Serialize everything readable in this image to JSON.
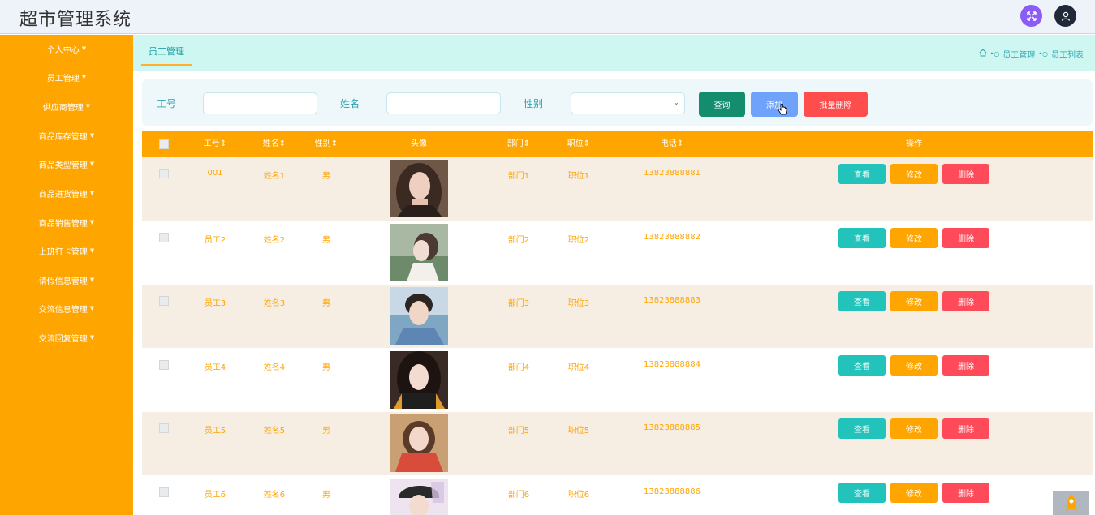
{
  "app": {
    "title": "超市管理系统"
  },
  "header": {
    "expand_icon": "expand-icon",
    "user_icon": "user-icon"
  },
  "sidebar": {
    "items": [
      {
        "label": "个人中心"
      },
      {
        "label": "员工管理"
      },
      {
        "label": "供应商管理"
      },
      {
        "label": "商品库存管理"
      },
      {
        "label": "商品类型管理"
      },
      {
        "label": "商品进货管理"
      },
      {
        "label": "商品销售管理"
      },
      {
        "label": "上班打卡管理"
      },
      {
        "label": "请假信息管理"
      },
      {
        "label": "交流信息管理"
      },
      {
        "label": "交流回复管理"
      }
    ]
  },
  "tabs": {
    "active": "员工管理"
  },
  "breadcrumb": {
    "level1": "员工管理",
    "level2": "员工列表"
  },
  "search": {
    "labels": {
      "emp_no": "工号",
      "name": "姓名",
      "gender": "性别"
    },
    "values": {
      "emp_no": "",
      "name": "",
      "gender": ""
    },
    "buttons": {
      "query": "查询",
      "add": "添加",
      "batch_delete": "批量删除"
    }
  },
  "table": {
    "headers": {
      "emp_no": "工号",
      "name": "姓名",
      "gender": "性别",
      "avatar": "头像",
      "dept": "部门",
      "position": "职位",
      "phone": "电话",
      "actions": "操作"
    },
    "sort_glyph": "⇕",
    "rows": [
      {
        "emp_no": "001",
        "name": "姓名1",
        "gender": "男",
        "dept": "部门1",
        "position": "职位1",
        "phone": "13823888881"
      },
      {
        "emp_no": "员工2",
        "name": "姓名2",
        "gender": "男",
        "dept": "部门2",
        "position": "职位2",
        "phone": "13823888882"
      },
      {
        "emp_no": "员工3",
        "name": "姓名3",
        "gender": "男",
        "dept": "部门3",
        "position": "职位3",
        "phone": "13823888883"
      },
      {
        "emp_no": "员工4",
        "name": "姓名4",
        "gender": "男",
        "dept": "部门4",
        "position": "职位4",
        "phone": "13823888884"
      },
      {
        "emp_no": "员工5",
        "name": "姓名5",
        "gender": "男",
        "dept": "部门5",
        "position": "职位5",
        "phone": "13823888885"
      },
      {
        "emp_no": "员工6",
        "name": "姓名6",
        "gender": "男",
        "dept": "部门6",
        "position": "职位6",
        "phone": "13823888886"
      }
    ],
    "row_actions": {
      "view": "查看",
      "edit": "修改",
      "delete": "删除"
    }
  },
  "colors": {
    "primary": "#ffa500",
    "tab_bg": "#cef7f1",
    "accent_teal": "#21a1a9",
    "query_btn": "#138d6e",
    "add_btn": "#6fa3fb",
    "delete_btn": "#fe4d4d"
  }
}
